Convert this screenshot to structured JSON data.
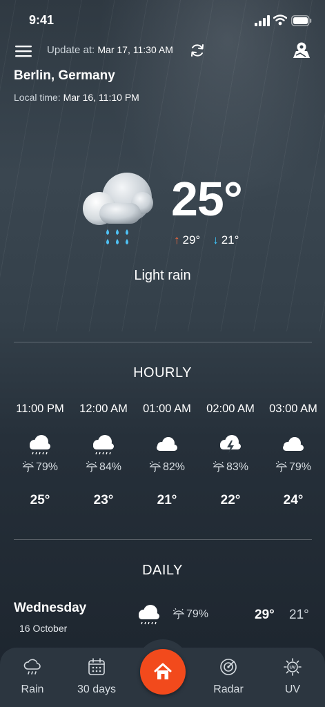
{
  "status_bar": {
    "time": "9:41"
  },
  "header": {
    "update_label": "Update at:",
    "update_value": "Mar 17, 11:30 AM",
    "city": "Berlin, Germany",
    "local_label": "Local time:",
    "local_value": "Mar 16, 11:10 PM"
  },
  "current": {
    "temperature": "25°",
    "high": "29°",
    "low": "21°",
    "condition": "Light rain",
    "icon": "rain-cloud-icon"
  },
  "hourly": {
    "title": "HOURLY",
    "items": [
      {
        "time": "11:00 PM",
        "icon": "rain-cloud-icon",
        "humidity": "79%",
        "temp": "25°"
      },
      {
        "time": "12:00 AM",
        "icon": "rain-cloud-icon",
        "humidity": "84%",
        "temp": "23°"
      },
      {
        "time": "01:00 AM",
        "icon": "cloud-icon",
        "humidity": "82%",
        "temp": "21°"
      },
      {
        "time": "02:00 AM",
        "icon": "thunderstorm-icon",
        "humidity": "83%",
        "temp": "22°"
      },
      {
        "time": "03:00 AM",
        "icon": "cloud-icon",
        "humidity": "79%",
        "temp": "24°"
      }
    ]
  },
  "daily": {
    "title": "DAILY",
    "items": [
      {
        "day": "Wednesday",
        "date": "16 October",
        "icon": "rain-cloud-icon",
        "humidity": "79%",
        "high": "29°",
        "low": "21°"
      }
    ]
  },
  "bottom_nav": {
    "items": [
      {
        "label": "Rain",
        "icon": "rain-cloud-icon"
      },
      {
        "label": "30 days",
        "icon": "calendar-icon"
      },
      {
        "label": "",
        "icon": "home-icon"
      },
      {
        "label": "Radar",
        "icon": "radar-icon"
      },
      {
        "label": "UV",
        "icon": "uv-sun-icon"
      }
    ]
  },
  "colors": {
    "accent": "#f24a1c",
    "high_arrow": "#ff6b3d",
    "low_arrow": "#3dc8ff",
    "raindrop": "#4fc3f7"
  }
}
